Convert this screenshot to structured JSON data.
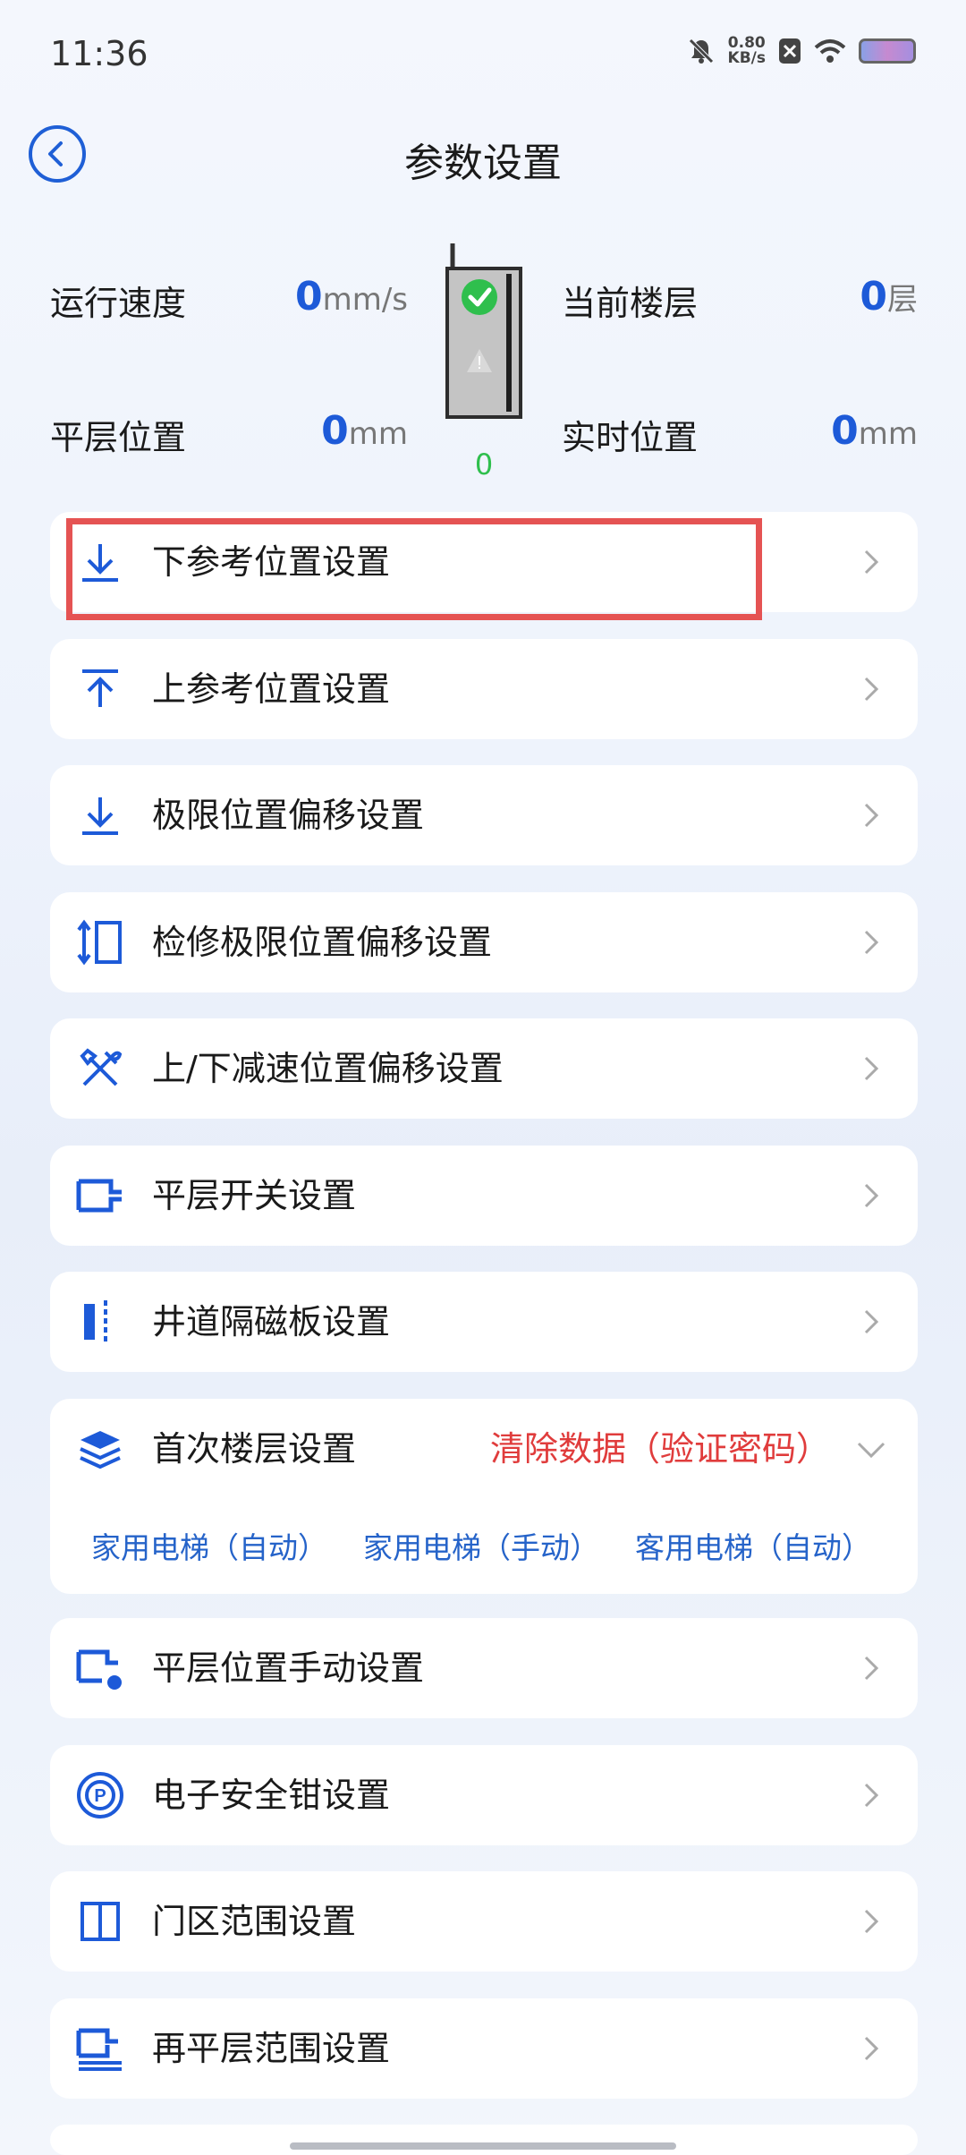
{
  "status": {
    "time": "11:36",
    "speed_value": "0.80",
    "speed_unit": "KB/s"
  },
  "header": {
    "title": "参数设置"
  },
  "info": {
    "speed_label": "运行速度",
    "speed_value": "0",
    "speed_unit": "mm/s",
    "floor_label": "当前楼层",
    "floor_value": "0",
    "floor_unit": "层",
    "level_label": "平层位置",
    "level_value": "0",
    "level_unit": "mm",
    "realtime_label": "实时位置",
    "realtime_value": "0",
    "realtime_unit": "mm",
    "elevator_value": "0"
  },
  "menu": [
    {
      "label": "下参考位置设置",
      "icon": "download-arrow-icon"
    },
    {
      "label": "上参考位置设置",
      "icon": "upload-arrow-icon"
    },
    {
      "label": "极限位置偏移设置",
      "icon": "download-arrow-icon"
    },
    {
      "label": "检修极限位置偏移设置",
      "icon": "vertical-range-icon"
    },
    {
      "label": "上/下减速位置偏移设置",
      "icon": "tools-icon"
    },
    {
      "label": "平层开关设置",
      "icon": "level-switch-icon"
    },
    {
      "label": "井道隔磁板设置",
      "icon": "magnet-plate-icon"
    },
    {
      "label": "首次楼层设置",
      "icon": "layers-icon",
      "warning": "清除数据（验证密码）",
      "options": [
        "家用电梯（自动）",
        "家用电梯（手动）",
        "客用电梯（自动）"
      ]
    },
    {
      "label": "平层位置手动设置",
      "icon": "manual-level-icon"
    },
    {
      "label": "电子安全钳设置",
      "icon": "parking-icon"
    },
    {
      "label": "门区范围设置",
      "icon": "door-zone-icon"
    },
    {
      "label": "再平层范围设置",
      "icon": "relevel-icon"
    }
  ],
  "colors": {
    "accent": "#1d5ad8",
    "warning": "#e03c3c",
    "highlight": "#e55353",
    "ok": "#2fbf4d"
  }
}
